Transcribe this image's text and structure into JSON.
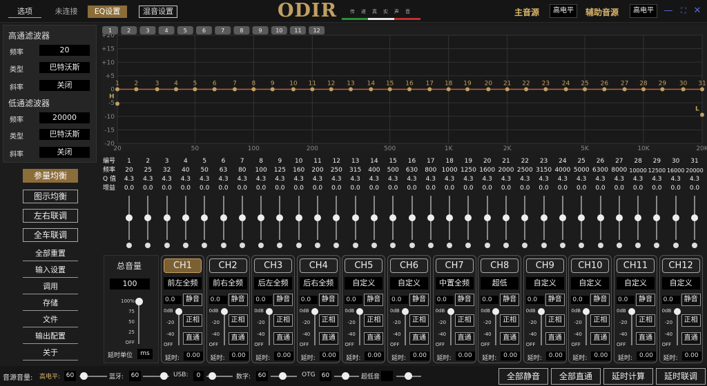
{
  "topbar": {
    "options_tab": "选项",
    "connection_status": "未连接",
    "eq_settings": "EQ设置",
    "mix_settings": "混音设置",
    "logo": "ODIR",
    "slogan": "传递真实声音",
    "main_source_label": "主音源",
    "main_source_value": "高电平",
    "aux_source_label": "辅助音源",
    "aux_source_value": "高电平"
  },
  "highpass": {
    "title": "高通滤波器",
    "freq_label": "频率",
    "freq": "20",
    "type_label": "类型",
    "type": "巴特沃斯",
    "slope_label": "斜率",
    "slope": "关闭"
  },
  "lowpass": {
    "title": "低通滤波器",
    "freq_label": "频率",
    "freq": "20000",
    "type_label": "类型",
    "type": "巴特沃斯",
    "slope_label": "斜率",
    "slope": "关闭"
  },
  "nav": {
    "param_eq": "参量均衡",
    "graphic_eq": "图示均衡",
    "lr_link": "左右联调",
    "car_link": "全车联调",
    "reset_all": "全部重置",
    "input_settings": "输入设置",
    "recall": "调用",
    "save": "存储",
    "file": "文件",
    "output_config": "输出配置",
    "about": "关于"
  },
  "graph": {
    "y_ticks": [
      "+20",
      "+15",
      "+10",
      "+5",
      "0",
      "-5",
      "-10",
      "-15",
      "-20"
    ],
    "x_ticks": [
      "20",
      "50",
      "100",
      "200",
      "500",
      "1K",
      "2K",
      "5K",
      "10K",
      "20K"
    ],
    "ch_tabs": [
      "1",
      "2",
      "3",
      "4",
      "5",
      "6",
      "7",
      "8",
      "9",
      "10",
      "11",
      "12"
    ],
    "h_marker": "H",
    "l_marker": "L",
    "line_color": "#c0a062"
  },
  "eq_table": {
    "row_labels": [
      "编号",
      "频率",
      "Q 值",
      "增益"
    ],
    "bands": [
      {
        "n": "1",
        "f": "20",
        "q": "4.3",
        "g": "0.0"
      },
      {
        "n": "2",
        "f": "25",
        "q": "4.3",
        "g": "0.0"
      },
      {
        "n": "3",
        "f": "32",
        "q": "4.3",
        "g": "0.0"
      },
      {
        "n": "4",
        "f": "40",
        "q": "4.3",
        "g": "0.0"
      },
      {
        "n": "5",
        "f": "50",
        "q": "4.3",
        "g": "0.0"
      },
      {
        "n": "6",
        "f": "63",
        "q": "4.3",
        "g": "0.0"
      },
      {
        "n": "7",
        "f": "80",
        "q": "4.3",
        "g": "0.0"
      },
      {
        "n": "8",
        "f": "100",
        "q": "4.3",
        "g": "0.0"
      },
      {
        "n": "9",
        "f": "125",
        "q": "4.3",
        "g": "0.0"
      },
      {
        "n": "10",
        "f": "160",
        "q": "4.3",
        "g": "0.0"
      },
      {
        "n": "11",
        "f": "200",
        "q": "4.3",
        "g": "0.0"
      },
      {
        "n": "12",
        "f": "250",
        "q": "4.3",
        "g": "0.0"
      },
      {
        "n": "13",
        "f": "315",
        "q": "4.3",
        "g": "0.0"
      },
      {
        "n": "14",
        "f": "400",
        "q": "4.3",
        "g": "0.0"
      },
      {
        "n": "15",
        "f": "500",
        "q": "4.3",
        "g": "0.0"
      },
      {
        "n": "16",
        "f": "630",
        "q": "4.3",
        "g": "0.0"
      },
      {
        "n": "17",
        "f": "800",
        "q": "4.3",
        "g": "0.0"
      },
      {
        "n": "18",
        "f": "1000",
        "q": "4.3",
        "g": "0.0"
      },
      {
        "n": "19",
        "f": "1250",
        "q": "4.3",
        "g": "0.0"
      },
      {
        "n": "20",
        "f": "1600",
        "q": "4.3",
        "g": "0.0"
      },
      {
        "n": "21",
        "f": "2000",
        "q": "4.3",
        "g": "0.0"
      },
      {
        "n": "22",
        "f": "2500",
        "q": "4.3",
        "g": "0.0"
      },
      {
        "n": "23",
        "f": "3150",
        "q": "4.3",
        "g": "0.0"
      },
      {
        "n": "24",
        "f": "4000",
        "q": "4.3",
        "g": "0.0"
      },
      {
        "n": "25",
        "f": "5000",
        "q": "4.3",
        "g": "0.0"
      },
      {
        "n": "26",
        "f": "6300",
        "q": "4.3",
        "g": "0.0"
      },
      {
        "n": "27",
        "f": "8000",
        "q": "4.3",
        "g": "0.0"
      },
      {
        "n": "28",
        "f": "10000",
        "q": "4.3",
        "g": "0.0"
      },
      {
        "n": "29",
        "f": "12500",
        "q": "4.3",
        "g": "0.0"
      },
      {
        "n": "30",
        "f": "16000",
        "q": "4.3",
        "g": "0.0"
      },
      {
        "n": "31",
        "f": "20000",
        "q": "4.3",
        "g": "0.0"
      }
    ]
  },
  "master": {
    "title": "总音量",
    "value": "100",
    "scale": [
      "100%",
      "75",
      "50",
      "25",
      "OFF"
    ],
    "delay_unit_label": "延时单位",
    "delay_unit": "ms"
  },
  "channels": [
    {
      "id": "CH1",
      "name": "前左全频",
      "vol": "0.0",
      "delay": "0.00",
      "active": true
    },
    {
      "id": "CH2",
      "name": "前右全频",
      "vol": "0.0",
      "delay": "0.00",
      "active": false
    },
    {
      "id": "CH3",
      "name": "后左全频",
      "vol": "0.0",
      "delay": "0.00",
      "active": false
    },
    {
      "id": "CH4",
      "name": "后右全频",
      "vol": "0.0",
      "delay": "0.00",
      "active": false
    },
    {
      "id": "CH5",
      "name": "自定义",
      "vol": "0.0",
      "delay": "0.00",
      "active": false
    },
    {
      "id": "CH6",
      "name": "自定义",
      "vol": "0.0",
      "delay": "0.00",
      "active": false
    },
    {
      "id": "CH7",
      "name": "中置全频",
      "vol": "0.0",
      "delay": "0.00",
      "active": false
    },
    {
      "id": "CH8",
      "name": "超低",
      "vol": "0.0",
      "delay": "0.00",
      "active": false
    },
    {
      "id": "CH9",
      "name": "自定义",
      "vol": "0.0",
      "delay": "0.00",
      "active": false
    },
    {
      "id": "CH10",
      "name": "自定义",
      "vol": "0.0",
      "delay": "0.00",
      "active": false
    },
    {
      "id": "CH11",
      "name": "自定义",
      "vol": "0.0",
      "delay": "0.00",
      "active": false
    },
    {
      "id": "CH12",
      "name": "自定义",
      "vol": "0.0",
      "delay": "0.00",
      "active": false
    }
  ],
  "channel_labels": {
    "mute": "静音",
    "phase": "正相",
    "direct": "直通",
    "delay": "延时:",
    "scale": [
      "0dB",
      "-20",
      "-40",
      "OFF"
    ]
  },
  "bottom": {
    "src_vol_label": "音源音量:",
    "high_level_label": "高电平:",
    "high_level": "60",
    "bt_label": "蓝牙:",
    "bt": "60",
    "usb_label": "USB:",
    "usb": "0",
    "digital_label": "数字:",
    "digital": "60",
    "otg_label": "OTG",
    "otg": "60",
    "sub_label": "超低音",
    "sub": "",
    "all_mute": "全部静音",
    "all_direct": "全部直通",
    "delay_calc": "延时计算",
    "delay_link": "延时联调"
  }
}
